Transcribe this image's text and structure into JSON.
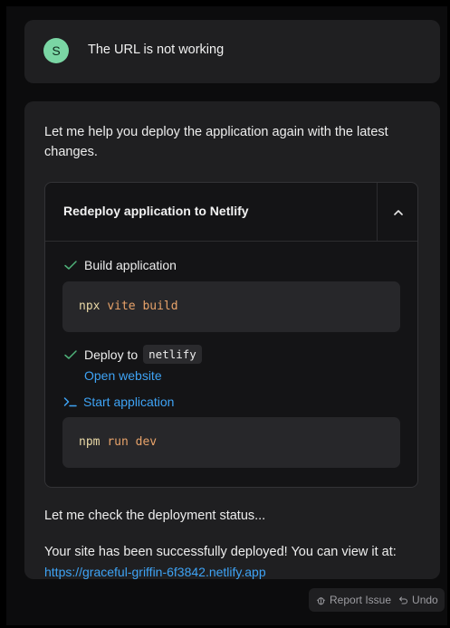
{
  "user_message": {
    "avatar_initial": "S",
    "text": "The URL is not working"
  },
  "assistant": {
    "intro": "Let me help you deploy the application again with the latest changes.",
    "action": {
      "title": "Redeploy application to Netlify",
      "collapse_icon": "chevron-up-icon",
      "steps": [
        {
          "label": "Build application",
          "status_icon": "check-icon",
          "command": {
            "cmd": "npx",
            "args": "vite build"
          }
        },
        {
          "label": "Deploy to",
          "status_icon": "check-icon",
          "target": "netlify",
          "link": "Open website"
        },
        {
          "label": "Start application",
          "status_icon": "terminal-icon",
          "command": {
            "cmd": "npm",
            "args": "run dev"
          }
        }
      ]
    },
    "status_text": "Let me check the deployment status...",
    "success_text": "Your site has been successfully deployed! You can view it at:",
    "site_url": "https://graceful-griffin-6f3842.netlify.app"
  },
  "footer": {
    "report_label": "Report Issue",
    "undo_label": "Undo"
  },
  "colors": {
    "background": "#0c0c0d",
    "card": "#1f1f21",
    "avatar": "#7ad6a4",
    "check": "#4fb37a",
    "link": "#3ea3f5",
    "command": "#e9d8a6",
    "argument": "#e8a36a"
  }
}
